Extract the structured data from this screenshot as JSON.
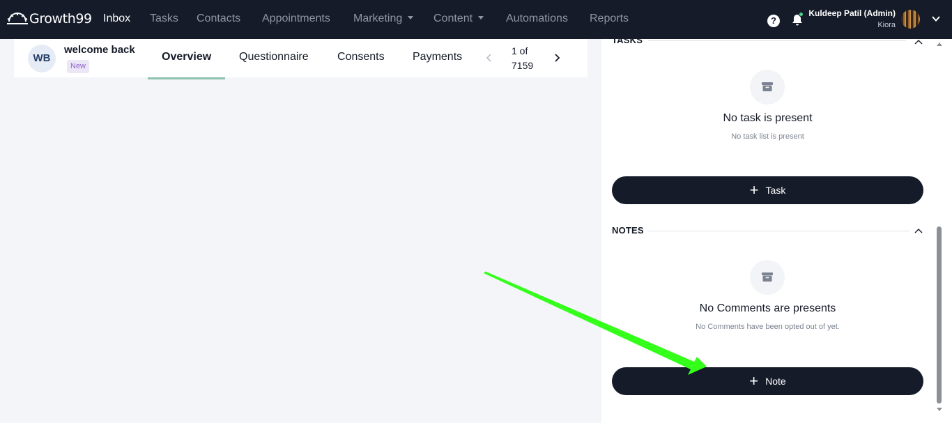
{
  "app": {
    "brand": "Growth99",
    "brand_icon": "sunrise-logo-icon"
  },
  "nav": {
    "items": [
      {
        "label": "Inbox",
        "active": true
      },
      {
        "label": "Tasks",
        "active": false
      },
      {
        "label": "Contacts",
        "active": false
      },
      {
        "label": "Appointments",
        "active": false
      },
      {
        "label": "Marketing",
        "active": false,
        "dropdown": true
      },
      {
        "label": "Content",
        "active": false,
        "dropdown": true
      },
      {
        "label": "Automations",
        "active": false
      },
      {
        "label": "Reports",
        "active": false
      }
    ]
  },
  "user": {
    "name": "Kuldeep Patil (Admin)",
    "org": "Kiora",
    "help_icon": "?",
    "notification_dot_color": "#4fd18b"
  },
  "contact": {
    "initials": "WB",
    "name": "welcome back",
    "status": "New"
  },
  "tabs": [
    {
      "label": "Overview",
      "active": true
    },
    {
      "label": "Questionnaire",
      "active": false
    },
    {
      "label": "Consents",
      "active": false
    },
    {
      "label": "Payments",
      "active": false
    }
  ],
  "pager": {
    "line1": "1 of",
    "line2": "7159"
  },
  "tasks_section": {
    "title": "TASKS",
    "empty_title": "No task is present",
    "empty_sub": "No task list is present",
    "button_icon": "+",
    "button_label": "Task"
  },
  "notes_section": {
    "title": "NOTES",
    "empty_title": "No Comments are presents",
    "empty_sub": "No Comments have been opted out of yet.",
    "button_icon": "+",
    "button_label": "Note"
  },
  "colors": {
    "nav_bg": "#151b29",
    "button_bg": "#151b29",
    "badge_bg": "#ece7f7",
    "badge_text": "#8a63c9",
    "tab_underline": "#8fc1b0",
    "annotation_arrow": "#33ff1a"
  }
}
